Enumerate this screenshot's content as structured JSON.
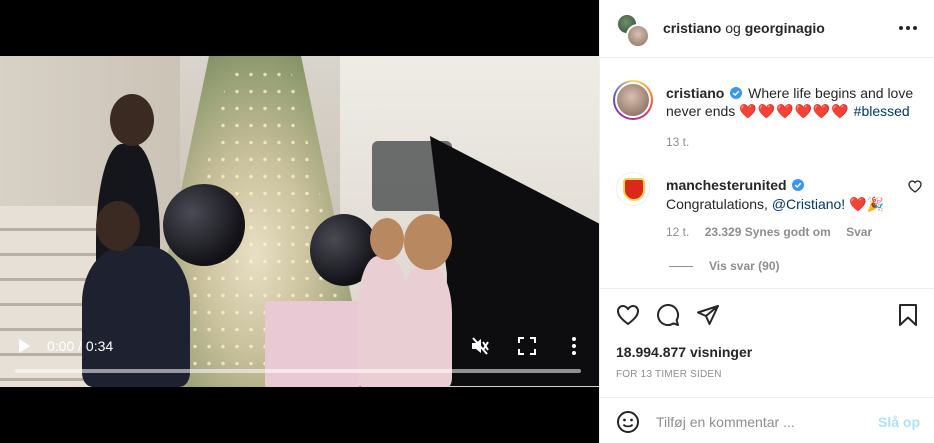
{
  "video": {
    "time_display": "0:00 / 0:34",
    "progress": 0,
    "icons": {
      "play": "play-icon",
      "mute": "muted-speaker-icon",
      "fullscreen": "fullscreen-icon",
      "more": "more-vertical-icon"
    }
  },
  "header": {
    "user1": "cristiano",
    "separator": "og",
    "user2": "georginagio",
    "more_icon": "more-horizontal-icon"
  },
  "caption": {
    "username": "cristiano",
    "text": "Where life begins and love never ends",
    "hearts": "❤️❤️❤️❤️❤️❤️",
    "hashtag": "#blessed",
    "time": "13 t."
  },
  "reply": {
    "username": "manchesterunited",
    "text_before": "Congratulations,",
    "mention": "@Cristiano!",
    "emoji": "❤️🎉",
    "time": "12 t.",
    "likes": "23.329 Synes godt om",
    "reply_label": "Svar",
    "view_replies": "Vis svar (90)"
  },
  "actions": {
    "views": "18.994.877 visninger",
    "posted": "FOR 13 TIMER SIDEN"
  },
  "comment_box": {
    "placeholder": "Tilføj en kommentar ...",
    "post_label": "Slå op"
  },
  "colors": {
    "link": "#00376b",
    "verified": "#3897f0",
    "heart": "#e0172d",
    "post_disabled": "#b2dffc",
    "muted_text": "#8e8e8e"
  }
}
